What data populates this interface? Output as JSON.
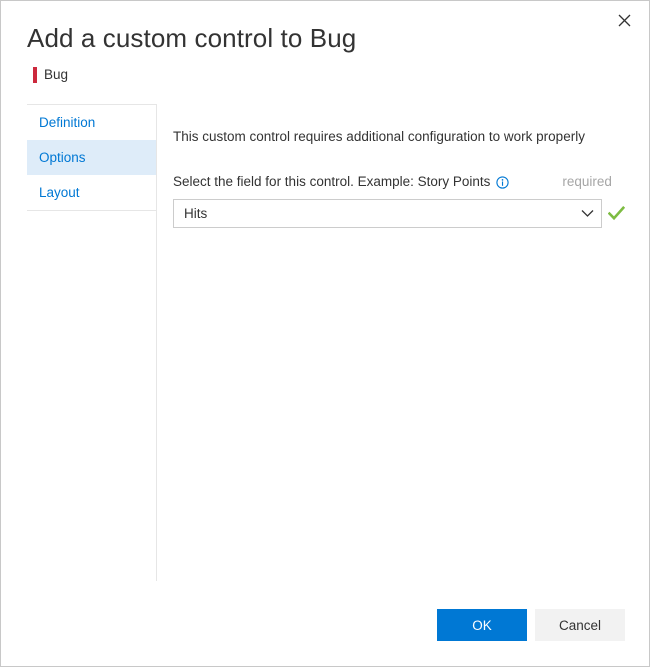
{
  "dialog": {
    "title": "Add a custom control to Bug",
    "close_icon": "close-icon",
    "work_item_type": {
      "label": "Bug",
      "color": "#cc293d"
    }
  },
  "sidebar": {
    "items": [
      {
        "label": "Definition",
        "selected": false
      },
      {
        "label": "Options",
        "selected": true
      },
      {
        "label": "Layout",
        "selected": false
      }
    ],
    "selected_background": "#deecf9",
    "link_color": "#0078d4"
  },
  "content": {
    "intro": "This custom control requires additional configuration to work properly",
    "field": {
      "label": "Select the field for this control. Example: Story Points",
      "info_icon": "info-icon",
      "required_tag": "required",
      "selected_value": "Hits",
      "chevron_icon": "chevron-down-icon",
      "validation_icon": "check-icon",
      "validation_color": "#7dbc42"
    }
  },
  "footer": {
    "ok_label": "OK",
    "cancel_label": "Cancel",
    "primary_color": "#0078d4",
    "secondary_color": "#f2f2f2"
  }
}
